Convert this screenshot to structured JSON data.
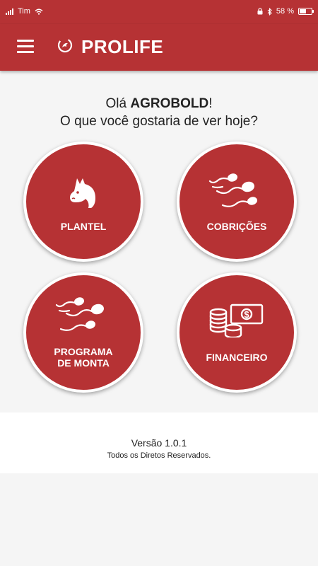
{
  "status_bar": {
    "carrier": "Tim",
    "battery_percent_text": "58 %",
    "battery_level": 0.58,
    "icons": [
      "signal-icon",
      "wifi-icon",
      "lock-icon",
      "bluetooth-icon",
      "battery-icon"
    ]
  },
  "app_bar": {
    "title": "PROLIFE",
    "menu_icon": "hamburger-menu-icon",
    "logo_icon": "prolife-logo-icon"
  },
  "greeting": {
    "prefix": "Olá ",
    "user": "AGROBOLD",
    "suffix": "!",
    "question": "O que você gostaria de ver hoje?"
  },
  "menu": [
    {
      "id": "plantel",
      "label": "PLANTEL",
      "icon": "horse-head-icon"
    },
    {
      "id": "cobricoes",
      "label": "COBRIÇÕES",
      "icon": "sperm-icon"
    },
    {
      "id": "programa",
      "label": "PROGRAMA\nDE MONTA",
      "icon": "sperm-icon"
    },
    {
      "id": "financeiro",
      "label": "FINANCEIRO",
      "icon": "money-icon"
    }
  ],
  "footer": {
    "version": "Versão 1.0.1",
    "rights": "Todos os Diretos Reservados."
  },
  "colors": {
    "primary": "#b63234",
    "background": "#f5f5f5",
    "text": "#222222"
  }
}
